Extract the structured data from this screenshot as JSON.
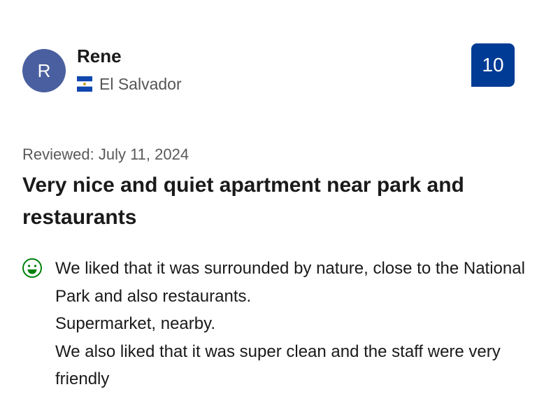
{
  "reviewer": {
    "initial": "R",
    "name": "Rene",
    "country": "El Salvador",
    "flag_icon": "el-salvador-flag-icon",
    "avatar_color": "#4a5f9f"
  },
  "score": {
    "value": "10",
    "badge_color": "#003b95"
  },
  "review": {
    "date": "Reviewed: July 11, 2024",
    "title": "Very nice and quiet apartment near park and restaurants",
    "positive_icon": "smiley-face-icon",
    "positive_icon_color": "#008009",
    "positive_lines": [
      "We liked that it was surrounded by nature, close to the National Park and also restaurants.",
      "Supermarket, nearby.",
      "We also liked that it was super clean and the staff were very friendly"
    ]
  }
}
